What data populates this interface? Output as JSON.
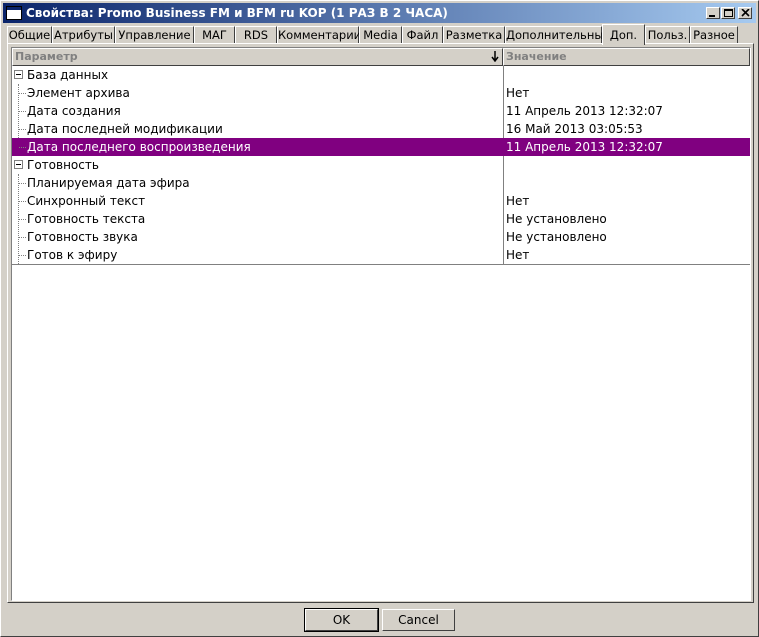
{
  "window": {
    "title": "Свойства: Promo Business FM и BFM ru KOP (1 РАЗ В 2 ЧАСА)"
  },
  "tabs": [
    {
      "label": "Общие"
    },
    {
      "label": "Атрибуты"
    },
    {
      "label": "Управление"
    },
    {
      "label": "МАГ"
    },
    {
      "label": "RDS"
    },
    {
      "label": "Комментарии"
    },
    {
      "label": "Media"
    },
    {
      "label": "Файл"
    },
    {
      "label": "Разметка"
    },
    {
      "label": "Дополнительные"
    },
    {
      "label": "Доп."
    },
    {
      "label": "Польз."
    },
    {
      "label": "Разное"
    }
  ],
  "active_tab": "Доп.",
  "grid": {
    "columns": [
      "Параметр",
      "Значение"
    ],
    "rows": [
      {
        "param": "База данных",
        "value": "",
        "group": true
      },
      {
        "param": "Элемент архива",
        "value": "Нет"
      },
      {
        "param": "Дата создания",
        "value": "11 Апрель 2013  12:32:07"
      },
      {
        "param": "Дата последней модификации",
        "value": "16 Май 2013  03:05:53"
      },
      {
        "param": "Дата последнего воспроизведения",
        "value": "11 Апрель 2013  12:32:07",
        "selected": true
      },
      {
        "param": "Готовность",
        "value": "",
        "group": true
      },
      {
        "param": "Планируемая дата эфира",
        "value": ""
      },
      {
        "param": "Синхронный текст",
        "value": "Нет"
      },
      {
        "param": "Готовность текста",
        "value": "Не установлено"
      },
      {
        "param": "Готовность звука",
        "value": "Не установлено"
      },
      {
        "param": "Готов к эфиру",
        "value": "Нет"
      }
    ]
  },
  "buttons": {
    "ok": "OK",
    "cancel": "Cancel"
  },
  "colors": {
    "selection": "#800080",
    "titlebar_start": "#0a246a",
    "titlebar_end": "#a6caf0"
  }
}
